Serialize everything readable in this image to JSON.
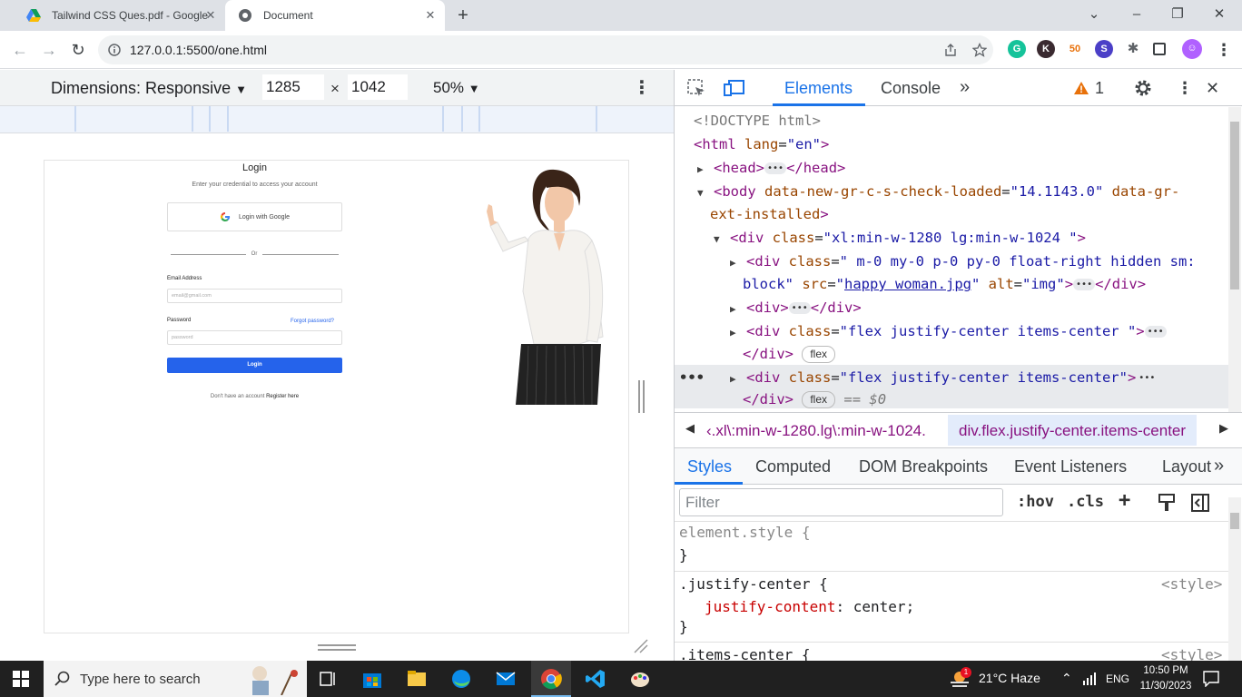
{
  "browser": {
    "tabs": [
      {
        "title": "Tailwind CSS Ques.pdf - Google",
        "icon": "google-drive-icon",
        "active": false
      },
      {
        "title": "Document",
        "icon": "globe-icon",
        "active": true
      }
    ],
    "url": "127.0.0.1:5500/one.html",
    "extensions": [
      "grammarly",
      "k-extension",
      "50-extension",
      "soul-extension",
      "puzzle-extensions"
    ]
  },
  "device_toolbar": {
    "dimensions_label": "Dimensions: Responsive",
    "width": "1285",
    "times": "×",
    "height": "1042",
    "zoom": "50%"
  },
  "page": {
    "title": "Login",
    "subtitle": "Enter your credential to access your account",
    "google_button": "Login with Google",
    "or": "Or",
    "email_label": "Email Address",
    "email_placeholder": "email@gmail.com",
    "password_label": "Password",
    "forgot": "Forgot password?",
    "password_placeholder": "password",
    "login_button": "Login",
    "register_text": "Don't have an account",
    "register_link": "Register here"
  },
  "devtools": {
    "tabs": [
      "Elements",
      "Console"
    ],
    "warnings": "1",
    "dom": {
      "doctype": "<!DOCTYPE html>",
      "html_open": "<html",
      "html_attr": " lang",
      "html_val": "\"en\"",
      "head_open": "<head>",
      "head_close": "</head>",
      "body_open": "<body",
      "body_attr1": " data-new-gr-c-s-check-loaded",
      "body_val1": "\"14.1143.0\"",
      "body_attr2": " data-gr-",
      "body_attr2b": "ext-installed",
      "div1_open": "<div",
      "div1_attr": " class",
      "div1_val": "\"xl:min-w-1280 lg:min-w-1024 \"",
      "div2_val": "\" m-0 my-0 p-0 py-0 float-right hidden sm:",
      "div2_val_b": "block\"",
      "src_attr": " src",
      "src_val": "happy woman.jpg",
      "alt_attr": " alt",
      "alt_val": "\"img\"",
      "div_close": "</div>",
      "div_short": "<div>",
      "div3_val": "\"flex justify-center items-center \"",
      "div4_val": "\"flex justify-center items-center\"",
      "flex_badge": "flex",
      "dollar": "== $0"
    },
    "breadcrumbs": [
      "‹.xl\\:min-w-1280.lg\\:min-w-1024.",
      "div.flex.justify-center.items-center"
    ],
    "styles_tabs": [
      "Styles",
      "Computed",
      "DOM Breakpoints",
      "Event Listeners",
      "Layout"
    ],
    "filter_placeholder": "Filter",
    "hov": ":hov",
    "cls": ".cls",
    "rules": {
      "element_style": "element.style {",
      "close": "}",
      "jc_selector": ".justify-center {",
      "jc_source": "<style>",
      "jc_prop": "justify-content",
      "jc_value": ": center;",
      "ic_selector": ".items-center {",
      "ic_source": "<style>"
    }
  },
  "taskbar": {
    "search_placeholder": "Type here to search",
    "weather": "21°C  Haze",
    "weather_badge": "1",
    "language": "ENG",
    "time": "10:50 PM",
    "date": "11/30/2023"
  }
}
